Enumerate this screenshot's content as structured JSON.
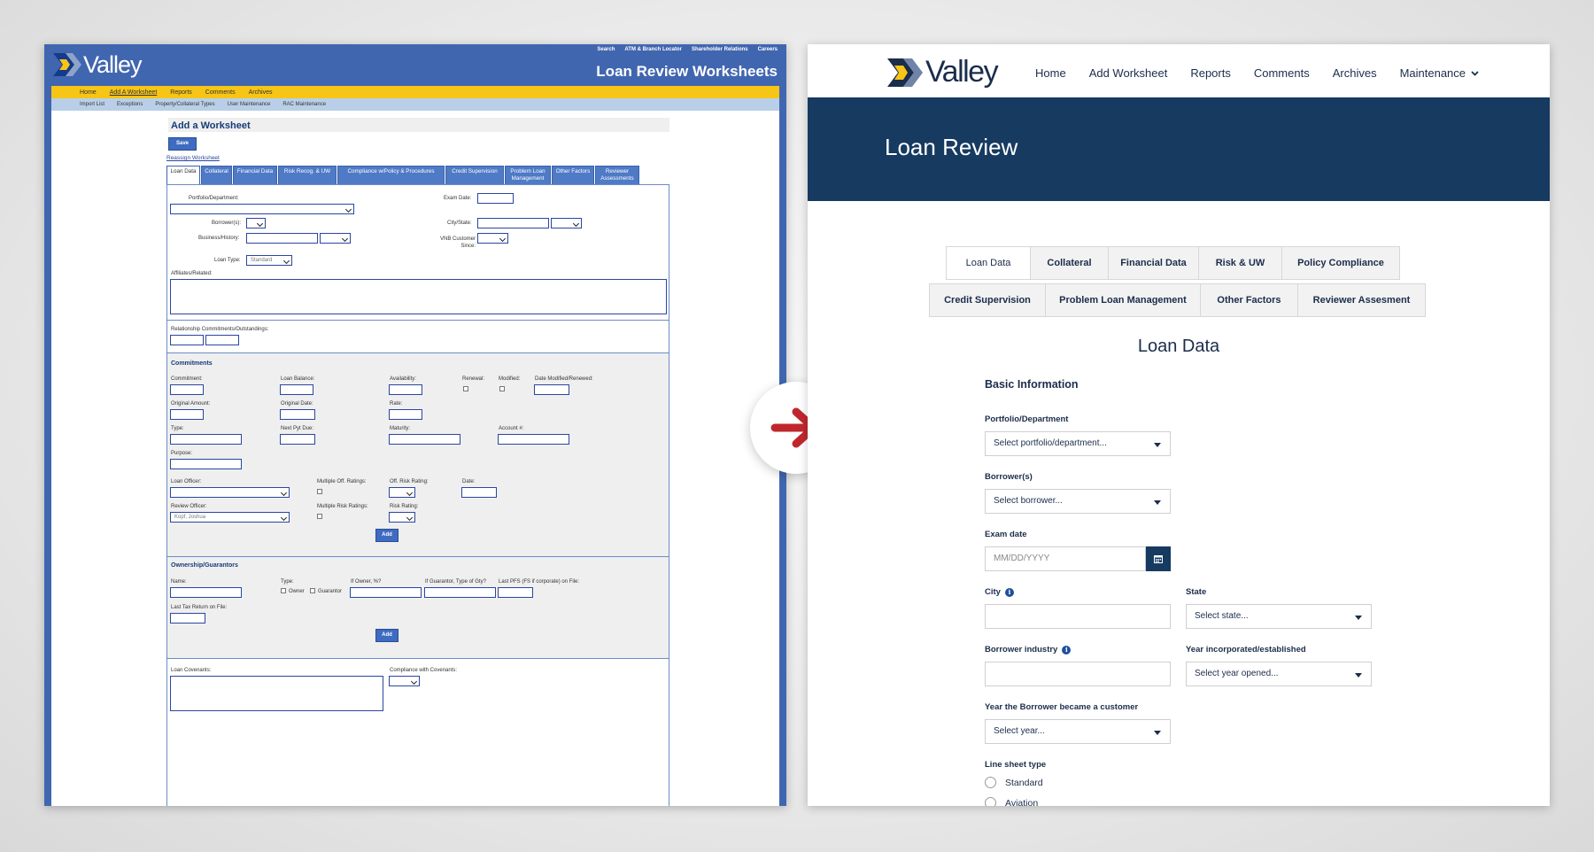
{
  "old": {
    "logo": "Valley",
    "util_links": [
      "Search",
      "ATM & Branch Locator",
      "Shareholder Relations",
      "Careers"
    ],
    "title": "Loan Review Worksheets",
    "nav": [
      "Home",
      "Add A Worksheet",
      "Reports",
      "Comments",
      "Archives"
    ],
    "subnav": [
      "Import List",
      "Exceptions",
      "Property/Collateral Types",
      "User Maintenance",
      "RAC Maintenance"
    ],
    "heading": "Add a Worksheet",
    "save": "Save",
    "reassign": "Reassign Worksheet",
    "tabs": [
      "Loan Data",
      "Collateral",
      "Financial Data",
      "Risk Recog. & UW",
      "Compliance w/Policy & Procedures",
      "Credit Supervision",
      "Problem Loan Management",
      "Other Factors",
      "Reviewer Assessments"
    ],
    "labels": {
      "portfolio": "Portfolio/Department:",
      "exam_date": "Exam Date:",
      "borrowers": "Borrower(s):",
      "city_state": "City/State:",
      "business": "Business/History:",
      "vnb": "VNB Customer Since:",
      "loan_type": "Loan Type:",
      "affiliates": "Affiliates/Related:",
      "relationship": "Relationship Commitments/Outstandings:",
      "commitments": "Commitments",
      "commitment": "Commitment:",
      "loan_balance": "Loan Balance:",
      "availability": "Availability:",
      "renewal": "Renewal:",
      "modified": "Modified:",
      "date_modified": "Date Modified/Renewed:",
      "original_amount": "Original Amount:",
      "original_date": "Original Date:",
      "rate": "Rate:",
      "type": "Type:",
      "next_pyt": "Next Pyt Due:",
      "maturity": "Maturity:",
      "account": "Account #:",
      "purpose": "Purpose:",
      "loan_officer": "Loan Officer:",
      "multiple_off": "Multiple Off. Ratings:",
      "off_risk": "Off. Risk Rating:",
      "date": "Date:",
      "review_officer": "Review Officer:",
      "multiple_risk": "Multiple Risk Ratings:",
      "risk_rating": "Risk Rating:",
      "add": "Add",
      "ownership": "Ownership/Guarantors",
      "name": "Name:",
      "otype": "Type:",
      "owner": "Owner",
      "guarantor": "Guarantor",
      "if_owner": "If Owner, %?",
      "if_guarantor": "If Guarantor, Type of Gty?",
      "last_pfs": "Last PFS (FS if corporate) on File:",
      "last_tax": "Last Tax Return on File:",
      "covenants": "Loan Covenants:",
      "compliance_cov": "Compliance with Covenants:"
    },
    "values": {
      "loan_type": "Standard",
      "review_officer": "Kopf, Joshua"
    }
  },
  "new": {
    "logo": "Valley",
    "nav": [
      "Home",
      "Add Worksheet",
      "Reports",
      "Comments",
      "Archives",
      "Maintenance"
    ],
    "hero_title": "Loan Review",
    "tabs_row1": [
      "Loan Data",
      "Collateral",
      "Financial Data",
      "Risk & UW",
      "Policy Compliance"
    ],
    "tabs_row2": [
      "Credit Supervision",
      "Problem Loan Management",
      "Other Factors",
      "Reviewer Assesment"
    ],
    "section_title": "Loan Data",
    "sub_title": "Basic Information",
    "fields": {
      "portfolio_label": "Portfolio/Department",
      "portfolio_value": "Select portfolio/department...",
      "borrower_label": "Borrower(s)",
      "borrower_value": "Select borrower...",
      "exam_label": "Exam date",
      "exam_placeholder": "MM/DD/YYYY",
      "city_label": "City",
      "state_label": "State",
      "state_value": "Select state...",
      "industry_label": "Borrower industry",
      "year_inc_label": "Year incorporated/established",
      "year_inc_value": "Select year opened...",
      "customer_label": "Year the Borrower became a customer",
      "customer_value": "Select year...",
      "linesheet_label": "Line sheet type",
      "radio_standard": "Standard",
      "radio_aviation": "Aviation"
    }
  },
  "colors": {
    "old_blue": "#4166b0",
    "old_yellow": "#f6c516",
    "new_navy": "#163a60",
    "arrow_red": "#c0272d"
  }
}
